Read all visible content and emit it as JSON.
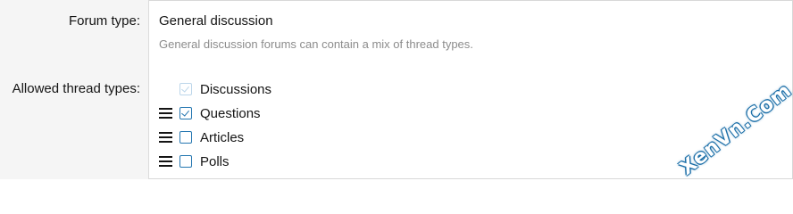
{
  "form": {
    "forum_type_label": "Forum type:",
    "forum_type_value": "General discussion",
    "forum_type_explain": "General discussion forums can contain a mix of thread types.",
    "allowed_types_label": "Allowed thread types:"
  },
  "thread_types": [
    {
      "label": "Discussions",
      "checked": true,
      "disabled": true,
      "draggable": false
    },
    {
      "label": "Questions",
      "checked": true,
      "disabled": false,
      "draggable": true
    },
    {
      "label": "Articles",
      "checked": false,
      "disabled": false,
      "draggable": true
    },
    {
      "label": "Polls",
      "checked": false,
      "disabled": false,
      "draggable": true
    }
  ],
  "watermark": {
    "text": "XenVn.Com"
  },
  "colors": {
    "accent": "#2577b1",
    "disabled_accent": "#bcd6ea",
    "label_bg": "#f5f5f5",
    "muted_text": "#8c8c8c"
  },
  "icons": {
    "drag_handle": "hamburger-lines-icon",
    "check": "checkmark-icon"
  }
}
